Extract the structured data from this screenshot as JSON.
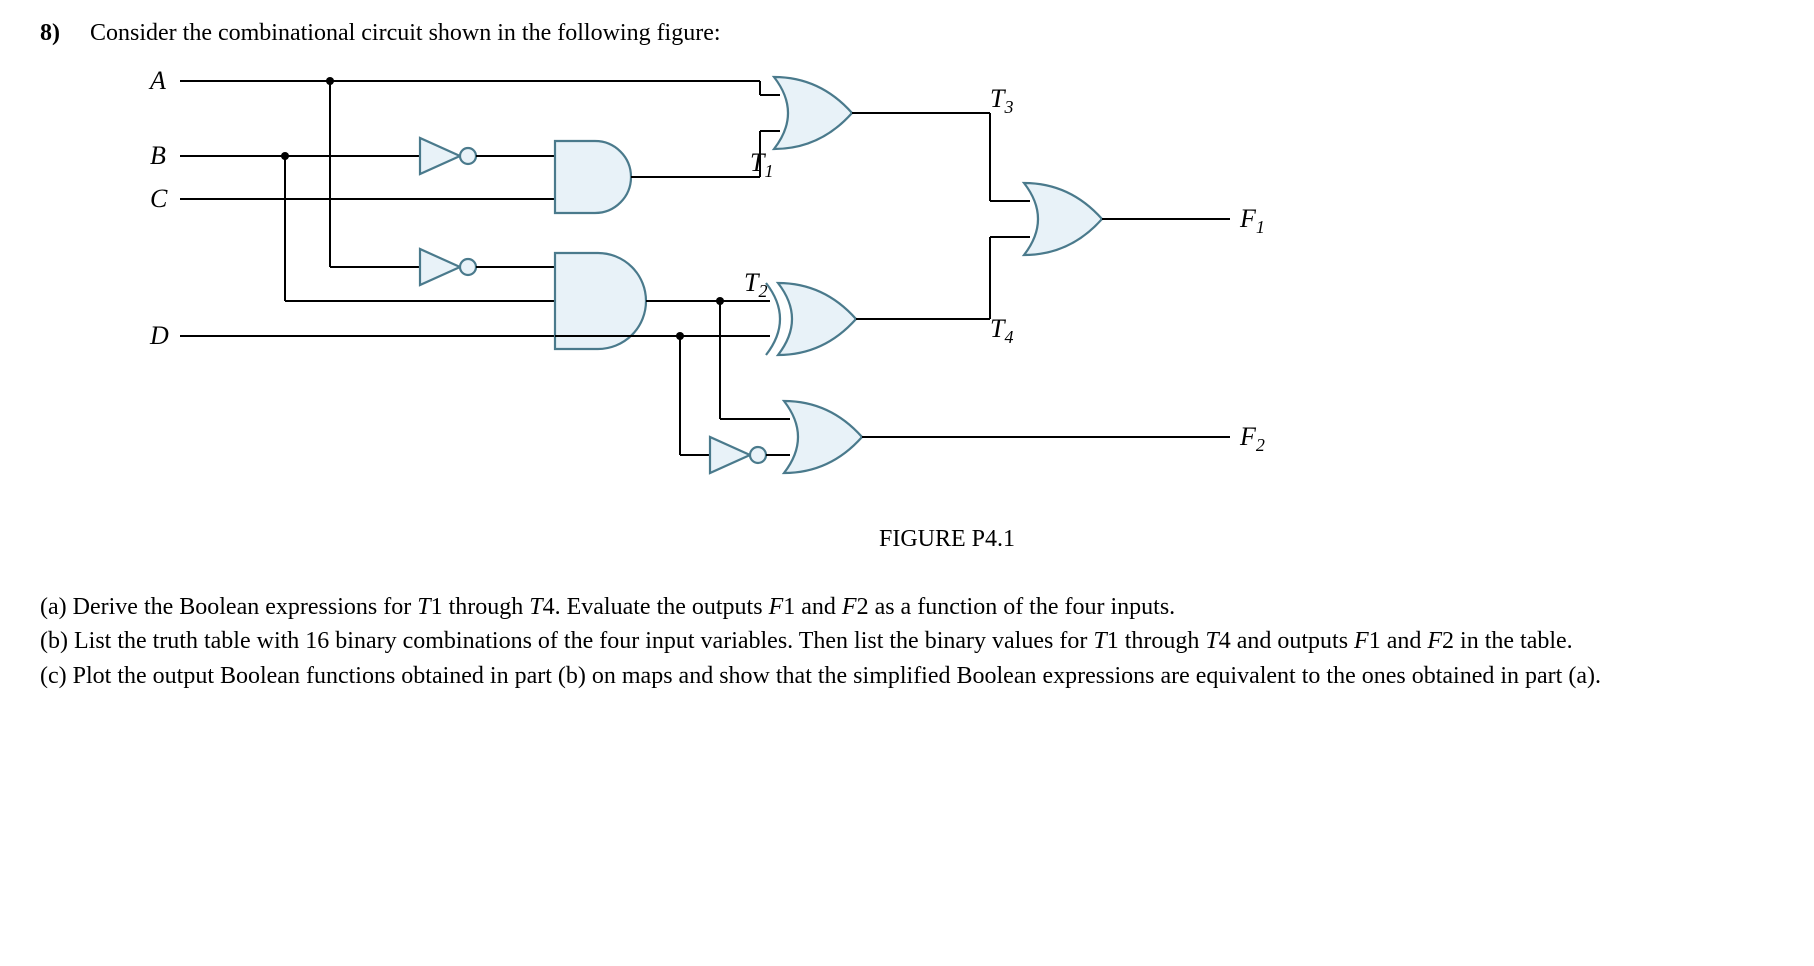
{
  "problem": {
    "number": "8)",
    "intro": "Consider the combinational circuit shown in the following figure:",
    "figure_caption": "FIGURE P4.1"
  },
  "circuit": {
    "inputs": [
      "A",
      "B",
      "C",
      "D"
    ],
    "intermediate": [
      "T1",
      "T2",
      "T3",
      "T4"
    ],
    "outputs": [
      "F1",
      "F2"
    ],
    "labels": {
      "A": "A",
      "B": "B",
      "C": "C",
      "D": "D",
      "T1": "T",
      "T1s": "1",
      "T2": "T",
      "T2s": "2",
      "T3": "T",
      "T3s": "3",
      "T4": "T",
      "T4s": "4",
      "F1": "F",
      "F1s": "1",
      "F2": "F",
      "F2s": "2"
    }
  },
  "parts": {
    "a_label": "(a)",
    "a_text1": " Derive the Boolean expressions for ",
    "a_T1": "T",
    "a_one": "1",
    "a_text2": " through ",
    "a_T4": "T",
    "a_four": "4",
    "a_text3": ". Evaluate the outputs ",
    "a_F1": "F",
    "a_text4": " and ",
    "a_F2": "F",
    "a_two": "2",
    "a_text5": " as a function of the four inputs.",
    "b_label": "(b)",
    "b_text1": " List the truth table with ",
    "b_sixteen": "16",
    "b_text2": " binary combinations of the four input variables. Then list the binary values for ",
    "b_T1": "T",
    "b_text3": " through ",
    "b_T4": "T",
    "b_text4": " and outputs ",
    "b_F1": "F",
    "b_text5": " and ",
    "b_F2": "F",
    "b_text6": " in the  table.",
    "c_label": "(c)",
    "c_text": " Plot the output Boolean functions obtained in part (b) on maps and show that the simplified Boolean expressions are equivalent to the ones obtained in part (a)."
  }
}
